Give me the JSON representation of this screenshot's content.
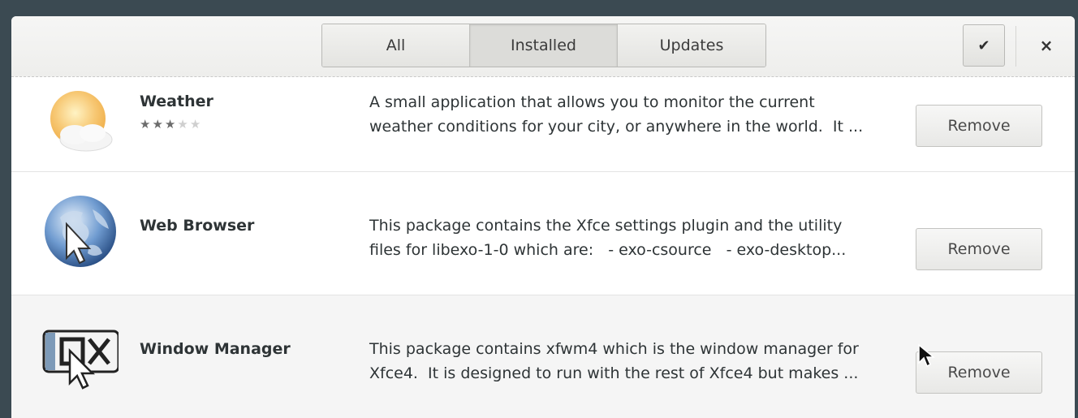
{
  "header": {
    "tabs": [
      {
        "label": "All"
      },
      {
        "label": "Installed"
      },
      {
        "label": "Updates"
      }
    ],
    "active_tab": "Installed",
    "confirm_icon": "checkmark-icon",
    "close_icon": "close-icon",
    "confirm_glyph": "✔",
    "close_glyph": "×"
  },
  "apps": [
    {
      "name": "Weather",
      "rating": 3,
      "rating_max": 5,
      "description": "A small application that allows you to monitor the current\nweather conditions for your city, or anywhere in the world.  It ...",
      "action_label": "Remove",
      "icon": "weather-icon"
    },
    {
      "name": "Web Browser",
      "description": "This package contains the Xfce settings plugin and the utility\nfiles for libexo-1-0 which are:   - exo-csource   - exo-desktop...",
      "action_label": "Remove",
      "icon": "web-browser-icon"
    },
    {
      "name": "Window Manager",
      "description": "This package contains xfwm4 which is the window manager for\nXfce4.  It is designed to run with the rest of Xfce4 but makes ...",
      "action_label": "Remove",
      "icon": "window-manager-icon"
    }
  ],
  "colors": {
    "star_on": "#6c6c6c",
    "star_off": "#cfcfcf"
  }
}
